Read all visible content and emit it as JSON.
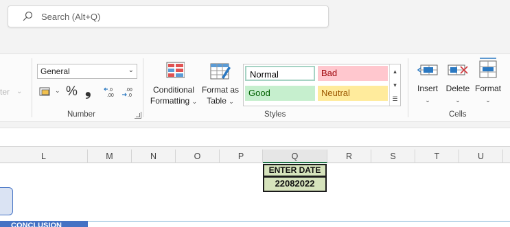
{
  "search": {
    "placeholder": "Search (Alt+Q)"
  },
  "ribbon": {
    "alignment_fragment": "ter",
    "number": {
      "format_value": "General",
      "group_label": "Number",
      "percent": "%",
      "comma": "̗",
      "increase_decimal": "←.0 .00",
      "decrease_decimal": ".00 →.0"
    },
    "conditional_formatting": {
      "line1": "Conditional",
      "line2": "Formatting"
    },
    "format_as_table": {
      "line1": "Format as",
      "line2": "Table"
    },
    "styles": {
      "group_label": "Styles",
      "normal": "Normal",
      "bad": "Bad",
      "good": "Good",
      "neutral": "Neutral"
    },
    "cells": {
      "group_label": "Cells",
      "insert": "Insert",
      "delete": "Delete",
      "format": "Format"
    }
  },
  "columns": [
    "L",
    "M",
    "N",
    "O",
    "P",
    "Q",
    "R",
    "S",
    "T",
    "U"
  ],
  "sheet": {
    "enter_date_label": "ENTER DATE",
    "enter_date_value": "22082022",
    "banner": "CONCLUSION"
  },
  "colors": {
    "good_bg": "#c6efce",
    "good_fg": "#006100",
    "bad_bg": "#ffc7ce",
    "bad_fg": "#9c0006",
    "neutral_bg": "#ffeb9c",
    "neutral_fg": "#9c5700",
    "accent": "#217346",
    "cell_fill": "#d6e3bc"
  }
}
